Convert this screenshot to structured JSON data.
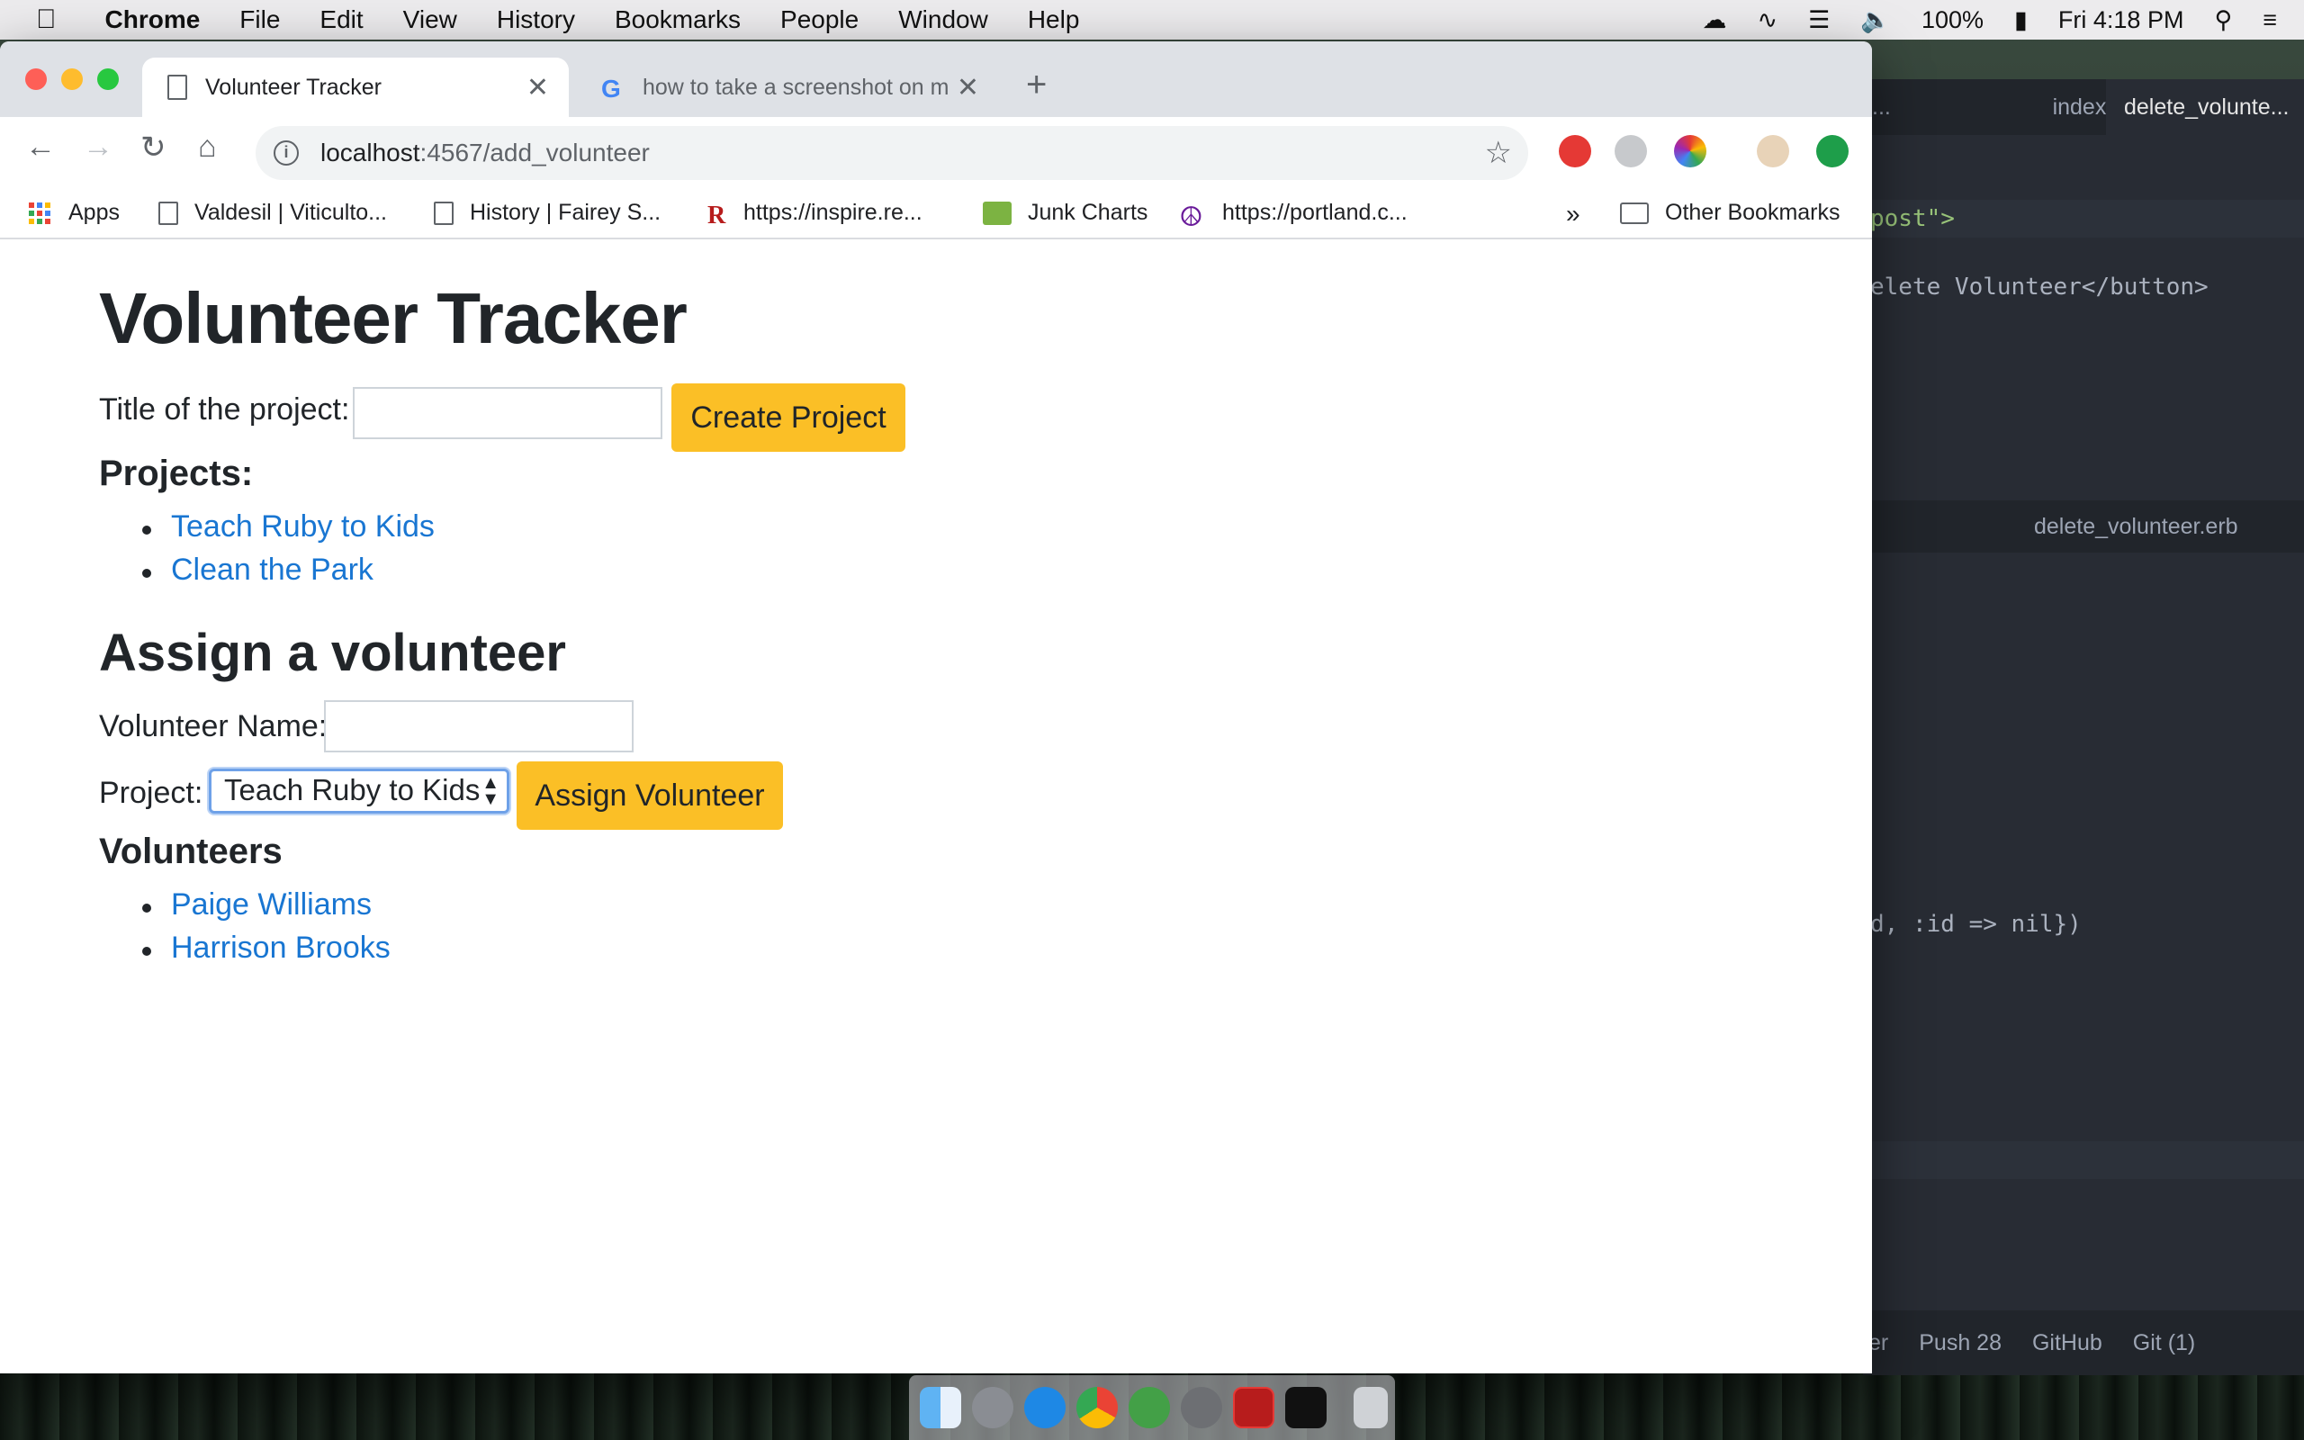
{
  "menubar": {
    "items": [
      "Chrome",
      "File",
      "Edit",
      "View",
      "History",
      "Bookmarks",
      "People",
      "Window",
      "Help"
    ],
    "battery": "100%",
    "clock": "Fri 4:18 PM"
  },
  "browser": {
    "tabs": [
      {
        "title": "Volunteer Tracker",
        "active": true
      },
      {
        "title": "how to take a screenshot on m",
        "active": false
      }
    ],
    "url": {
      "host": "localhost",
      "path": ":4567/add_volunteer"
    },
    "bookmarks": [
      "Apps",
      "Valdesil | Viticulto...",
      "History | Fairey S...",
      "https://inspire.re...",
      "Junk Charts",
      "https://portland.c..."
    ],
    "bookmarks_overflow": "»",
    "other_bookmarks": "Other Bookmarks"
  },
  "page": {
    "title": "Volunteer Tracker",
    "project_title_label": "Title of the project:",
    "project_title_value": "",
    "create_project_button": "Create Project",
    "projects_heading": "Projects:",
    "projects": [
      "Teach Ruby to Kids",
      "Clean the Park"
    ],
    "assign_heading": "Assign a volunteer",
    "volunteer_name_label": "Volunteer Name:",
    "volunteer_name_value": "",
    "project_label": "Project:",
    "project_selected": "Teach Ruby to Kids",
    "assign_button": "Assign Volunteer",
    "volunteers_heading": "Volunteers",
    "volunteers": [
      "Paige Williams",
      "Harrison Brooks"
    ]
  },
  "editor": {
    "tabs": [
      "...",
      "index.erb",
      "delete_volunte..."
    ],
    "pane2_tab": "delete_volunteer.erb",
    "lines": [
      "post\">",
      "elete Volunteer</button>",
      "d, :id => nil})"
    ],
    "status": [
      "er",
      "Push 28",
      "GitHub",
      "Git (1)"
    ]
  },
  "colors": {
    "accent_yellow": "#fbbf26",
    "link_blue": "#1976d2",
    "editor_bg": "#282c34"
  }
}
